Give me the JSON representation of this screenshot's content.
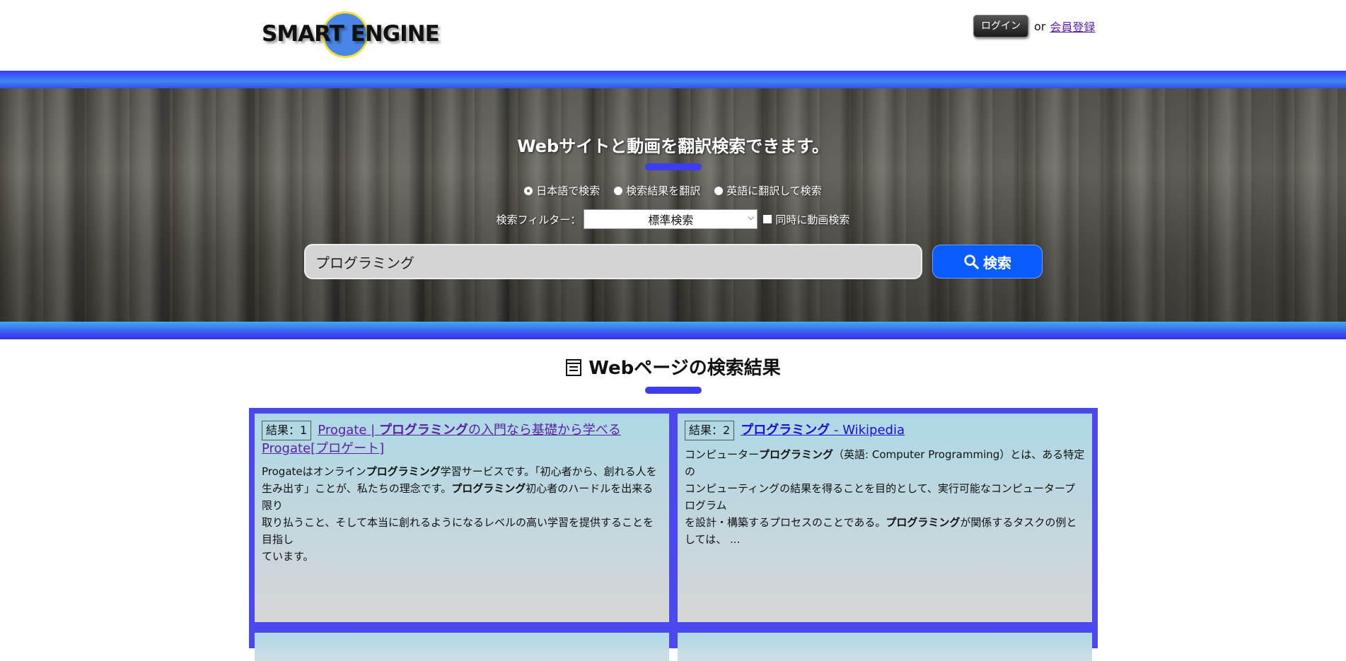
{
  "header": {
    "logo_text": "SMART ENGINE",
    "login_label": "ログイン",
    "or_text": "or",
    "signup_label": "会員登録"
  },
  "hero": {
    "title": "Webサイトと動画を翻訳検索できます。",
    "radio_options": [
      "日本語で検索",
      "検索結果を翻訳",
      "英語に翻訳して検索"
    ],
    "filter_label": "検索フィルター：",
    "filter_value": "標準検索",
    "video_checkbox_label": "同時に動画検索",
    "search_value": "プログラミング",
    "search_button_label": "検索"
  },
  "results": {
    "section_title": "Webページの検索結果",
    "items": [
      {
        "tag": "結果：1",
        "title_pre": "Progate | ",
        "title_bold": "プログラミング",
        "title_post": "の入門なら基礎から学べるProgate[プロゲート]",
        "body": [
          {
            "t": "Progateはオンライン",
            "b": false
          },
          {
            "t": "プログラミング",
            "b": true
          },
          {
            "t": "学習サービスです。「初心者から、創れる人を",
            "b": false
          },
          {
            "t": "\n生み出す」ことが、私たちの理念です。",
            "b": false
          },
          {
            "t": "プログラミング",
            "b": true
          },
          {
            "t": "初心者のハードルを出来る限り",
            "b": false
          },
          {
            "t": "\n取り払うこと、そして本当に創れるようになるレベルの高い学習を提供することを目指し",
            "b": false
          },
          {
            "t": "\nています。",
            "b": false
          }
        ]
      },
      {
        "tag": "結果：2",
        "title_pre": "",
        "title_bold": "プログラミング",
        "title_post": " - Wikipedia",
        "body": [
          {
            "t": "コンピューター",
            "b": false
          },
          {
            "t": "プログラミング",
            "b": true
          },
          {
            "t": "（英語: Computer Programming）とは、ある特定の",
            "b": false
          },
          {
            "t": "\nコンピューティングの結果を得ることを目的として、実行可能なコンピュータープログラム",
            "b": false
          },
          {
            "t": "\nを設計・構築するプロセスのことである。",
            "b": false
          },
          {
            "t": "プログラミング",
            "b": true
          },
          {
            "t": "が関係するタスクの例としては、 ...",
            "b": false
          }
        ]
      }
    ]
  },
  "colors": {
    "accent": "#3c3cf0",
    "search_button": "#0a5cff",
    "results_frame": "#4b48ee"
  }
}
